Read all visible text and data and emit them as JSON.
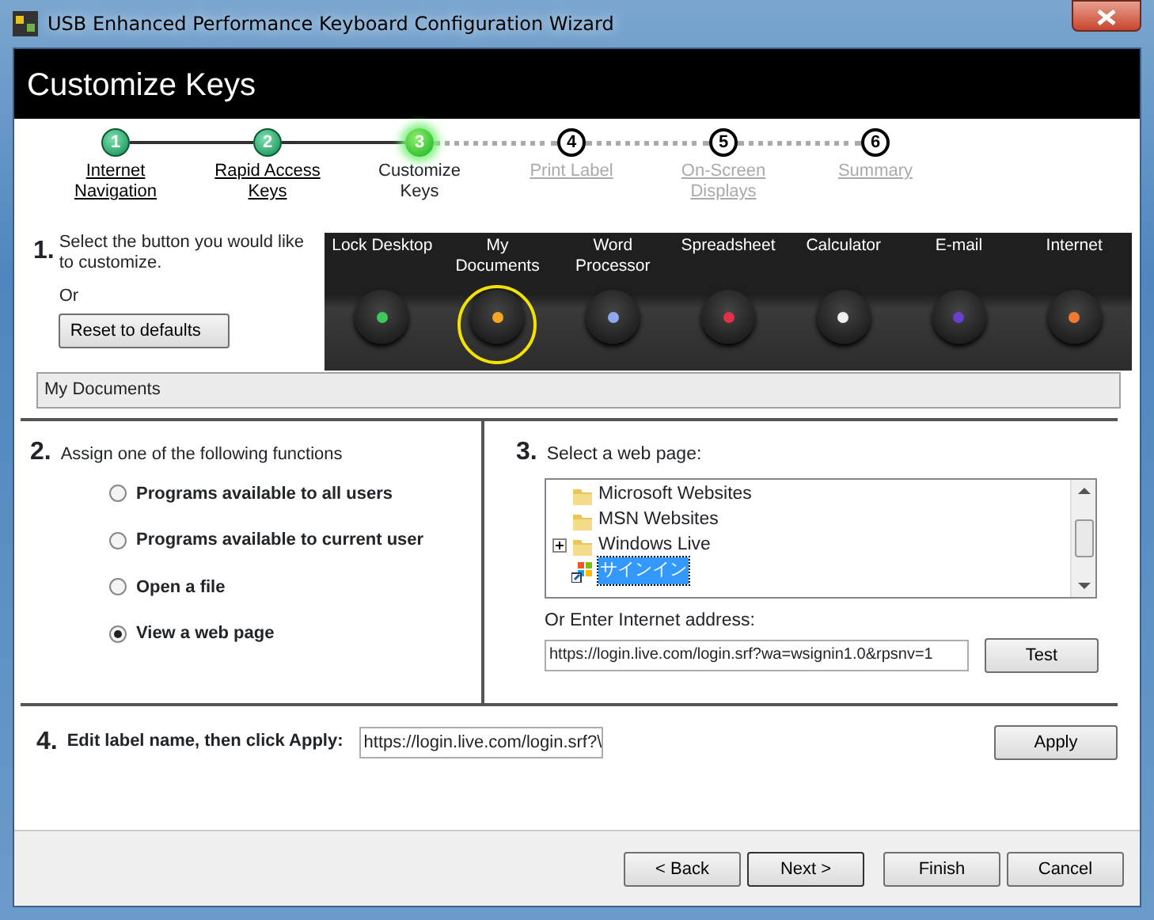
{
  "window": {
    "title": "USB Enhanced Performance Keyboard Configuration Wizard"
  },
  "header": {
    "title": "Customize Keys"
  },
  "steps": [
    {
      "number": "1",
      "label": "Internet Navigation",
      "completed": true,
      "selected": false
    },
    {
      "number": "2",
      "label": "Rapid Access Keys",
      "completed": true,
      "selected": false
    },
    {
      "number": "3",
      "label": "Customize Keys",
      "completed": false,
      "selected": true
    },
    {
      "number": "4",
      "label": "Print Label",
      "completed": false,
      "selected": false
    },
    {
      "number": "5",
      "label": "On-Screen Displays",
      "completed": false,
      "selected": false
    },
    {
      "number": "6",
      "label": "Summary",
      "completed": false,
      "selected": false
    }
  ],
  "section1": {
    "number": "1.",
    "instruction": "Select the button you would like to customize.",
    "or": "Or",
    "reset_button": "Reset to defaults",
    "keys": [
      {
        "label": "Lock Desktop",
        "color": "#3ec95a",
        "selected": false
      },
      {
        "label": "My Documents",
        "color": "#f5a623",
        "selected": true
      },
      {
        "label": "Word Processor",
        "color": "#8fa8f0",
        "selected": false
      },
      {
        "label": "Spreadsheet",
        "color": "#e0304a",
        "selected": false
      },
      {
        "label": "Calculator",
        "color": "#f0f0f0",
        "selected": false
      },
      {
        "label": "E-mail",
        "color": "#6a3fd0",
        "selected": false
      },
      {
        "label": "Internet",
        "color": "#f07a30",
        "selected": false
      }
    ],
    "selected_name": "My Documents"
  },
  "section2": {
    "number": "2.",
    "title": "Assign one of the following functions",
    "options": [
      {
        "label": "Programs available to all users",
        "selected": false
      },
      {
        "label": "Programs available to current user",
        "selected": false
      },
      {
        "label": "Open a file",
        "selected": false
      },
      {
        "label": "View a web page",
        "selected": true
      }
    ]
  },
  "section3": {
    "number": "3.",
    "title": "Select a web page:",
    "tree": [
      {
        "label": "Microsoft Websites",
        "kind": "folder",
        "expandable": false,
        "selected": false
      },
      {
        "label": "MSN Websites",
        "kind": "folder",
        "expandable": false,
        "selected": false
      },
      {
        "label": "Windows Live",
        "kind": "folder",
        "expandable": true,
        "selected": false
      },
      {
        "label": "サインイン",
        "kind": "link",
        "expandable": false,
        "selected": true
      }
    ],
    "address_label": "Or Enter Internet address:",
    "address": "https://login.live.com/login.srf?wa=wsignin1.0&rpsnv=1",
    "test_button": "Test"
  },
  "section4": {
    "number": "4.",
    "label": "Edit label name, then click Apply:",
    "value": "https://login.live.com/login.srf?\\",
    "apply_button": "Apply"
  },
  "buttons": [
    "< Back",
    "Next >",
    "Finish",
    "Cancel"
  ]
}
